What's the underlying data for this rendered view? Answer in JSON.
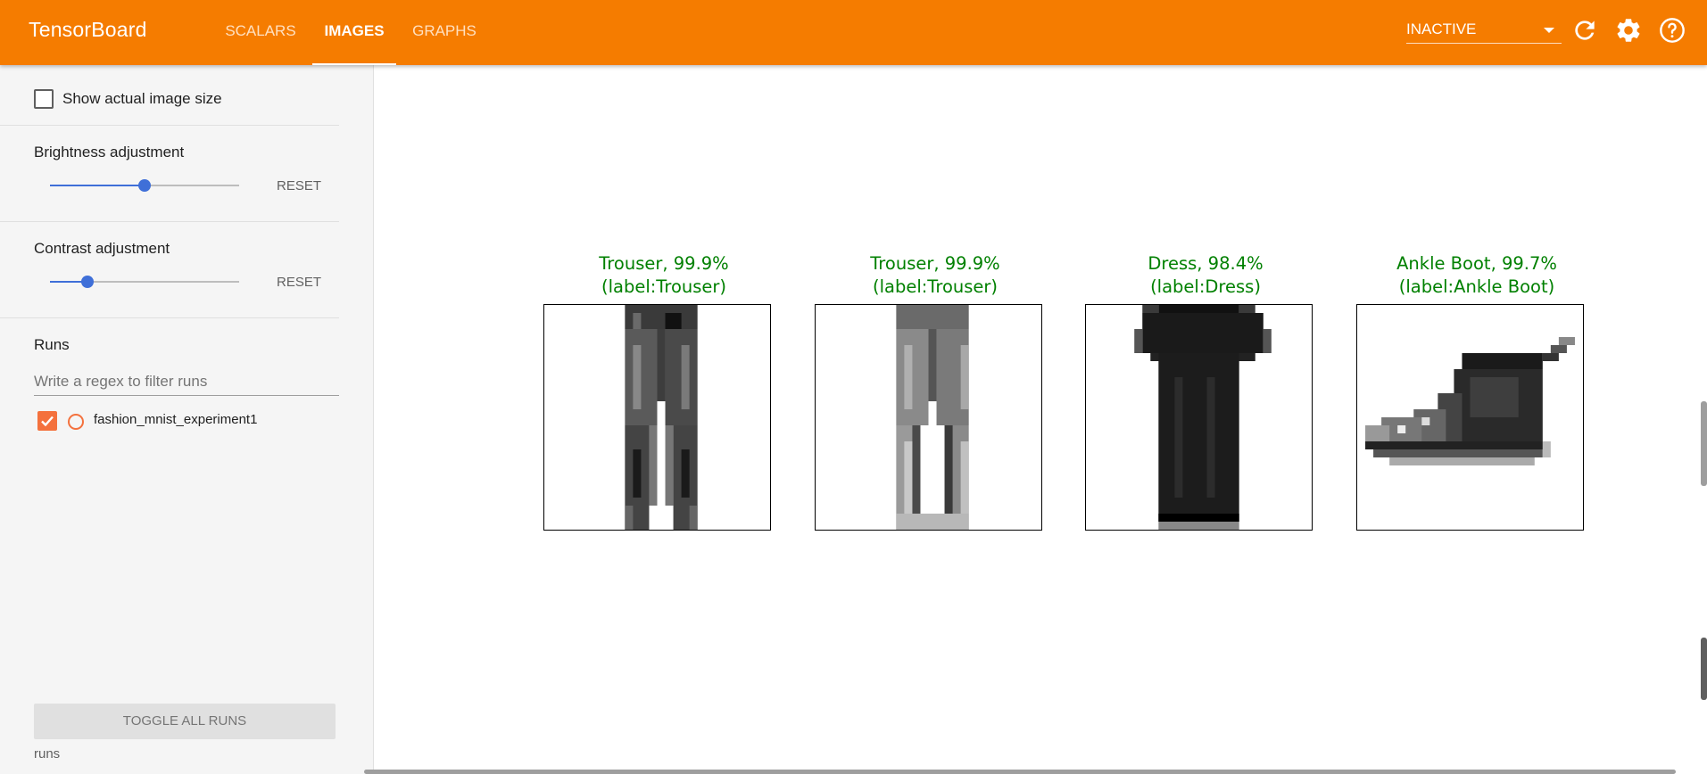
{
  "app": {
    "title": "TensorBoard",
    "tabs": [
      {
        "label": "SCALARS",
        "active": false
      },
      {
        "label": "IMAGES",
        "active": true
      },
      {
        "label": "GRAPHS",
        "active": false
      }
    ],
    "status_select": "INACTIVE",
    "icons": [
      "refresh-icon",
      "settings-icon",
      "help-icon"
    ],
    "accent_color": "#f57c00"
  },
  "sidebar": {
    "show_actual_size": {
      "label": "Show actual image size",
      "checked": false
    },
    "brightness": {
      "label": "Brightness adjustment",
      "value_fraction": 0.5,
      "reset_label": "RESET"
    },
    "contrast": {
      "label": "Contrast adjustment",
      "value_fraction": 0.2,
      "reset_label": "RESET"
    },
    "runs": {
      "title": "Runs",
      "filter_placeholder": "Write a regex to filter runs",
      "items": [
        {
          "name": "fashion_mnist_experiment1",
          "checked": true,
          "color": "#f4713d"
        }
      ],
      "toggle_all_label": "TOGGLE ALL RUNS",
      "footer": "runs"
    }
  },
  "main": {
    "images": [
      {
        "line1": "Trouser, 99.9%",
        "line2": "(label:Trouser)",
        "item": "trouser"
      },
      {
        "line1": "Trouser, 99.9%",
        "line2": "(label:Trouser)",
        "item": "trouser"
      },
      {
        "line1": "Dress, 98.4%",
        "line2": "(label:Dress)",
        "item": "dress"
      },
      {
        "line1": "Ankle Boot, 99.7%",
        "line2": "(label:Ankle Boot)",
        "item": "ankle-boot"
      }
    ],
    "caption_color": "#008000"
  }
}
